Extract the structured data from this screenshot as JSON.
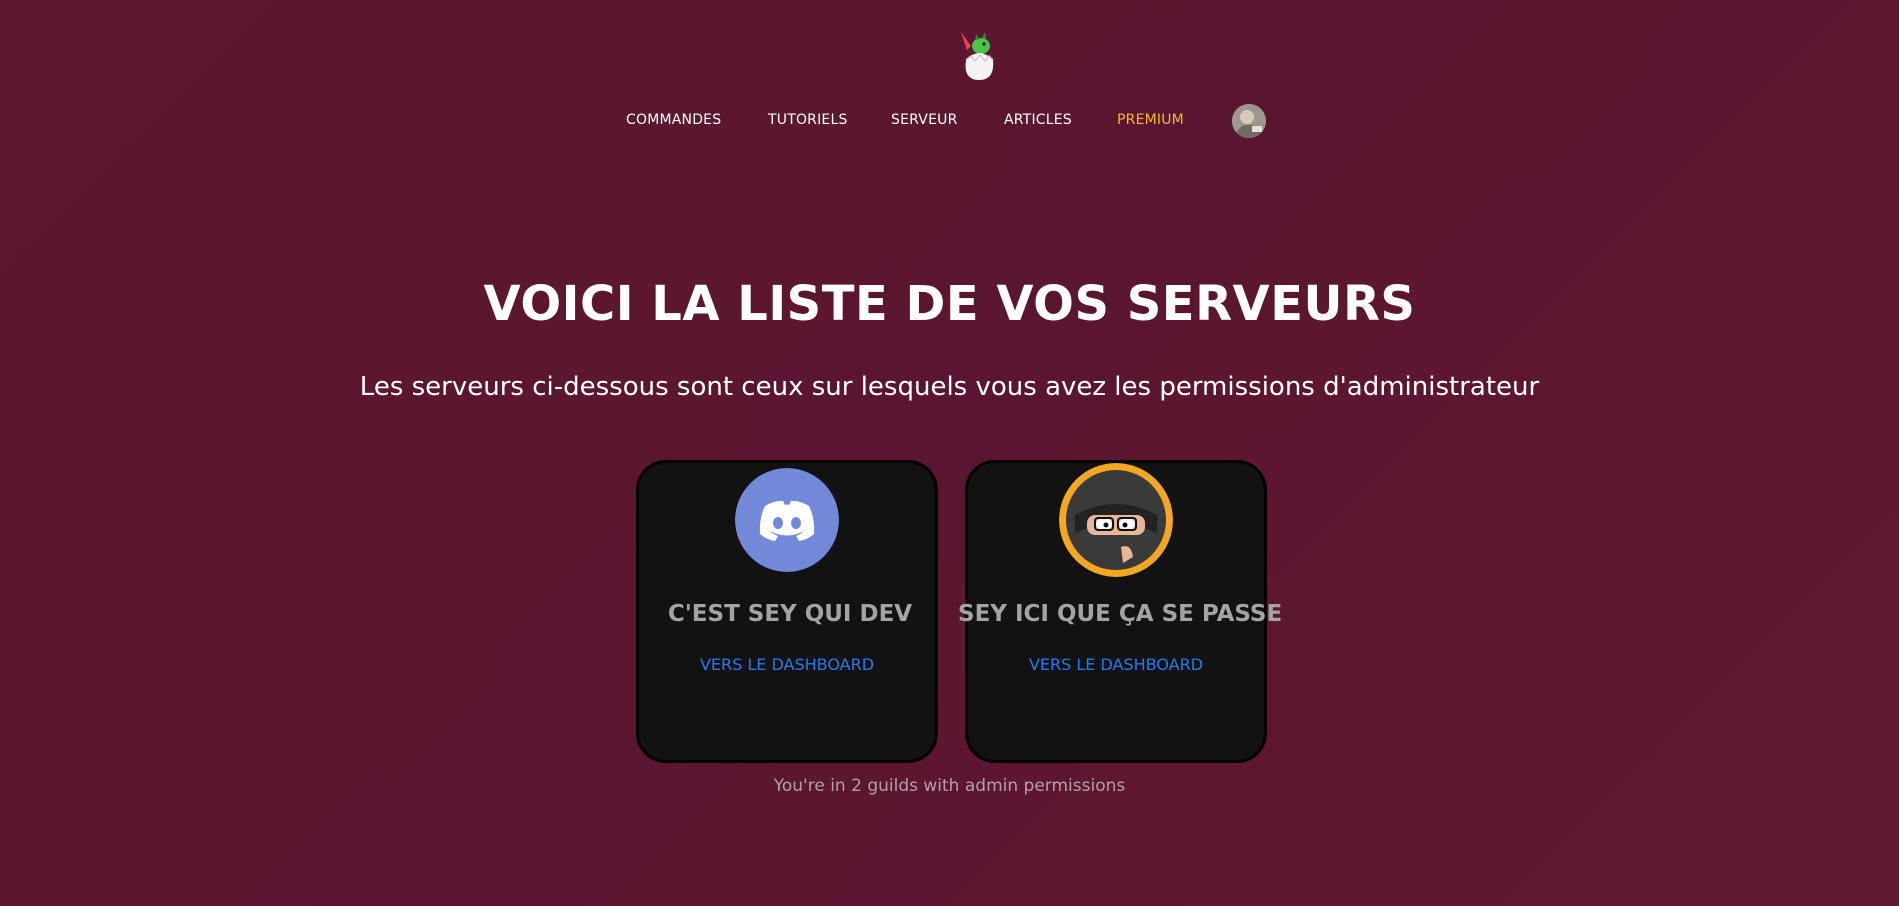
{
  "nav": {
    "items": [
      {
        "label": "COMMANDES"
      },
      {
        "label": "TUTORIELS"
      },
      {
        "label": "SERVEUR"
      },
      {
        "label": "ARTICLES"
      },
      {
        "label": "PREMIUM"
      }
    ]
  },
  "main": {
    "title": "VOICI LA LISTE DE VOS SERVEURS",
    "subtitle": "Les serveurs ci-dessous sont ceux sur lesquels vous avez les permissions d'administrateur"
  },
  "guilds": [
    {
      "name": "C'EST SEY QUI DEV",
      "link_label": "VERS LE DASHBOARD",
      "icon": "discord-logo-icon"
    },
    {
      "name": "SEY ICI QUE ÇA SE PASSE",
      "link_label": "VERS LE DASHBOARD",
      "icon": "ninja-avatar-icon"
    }
  ],
  "footer": {
    "note": "You're in 2 guilds with admin permissions"
  },
  "colors": {
    "background": "#5e1730",
    "premium": "#f6b928",
    "link": "#1f7bf2",
    "card": "#121212",
    "discord_blurple": "#7289da"
  }
}
